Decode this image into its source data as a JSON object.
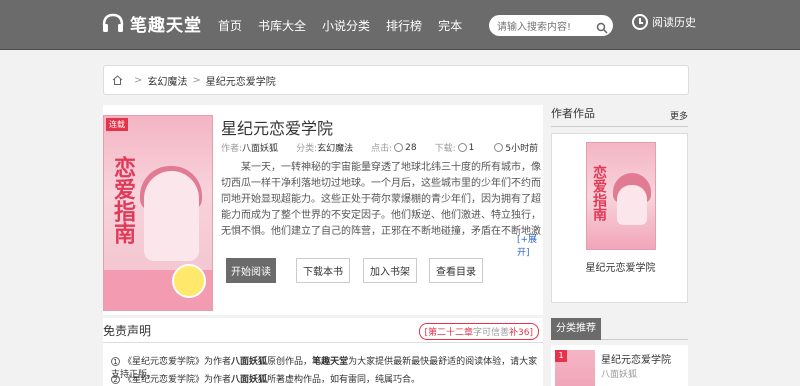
{
  "header": {
    "site_name": "笔趣天堂",
    "nav": [
      "首页",
      "书库大全",
      "小说分类",
      "排行榜",
      "完本"
    ],
    "search_placeholder": "请输入搜索内容!",
    "history_label": "阅读历史"
  },
  "breadcrumb": {
    "category": "玄幻魔法",
    "book": "星纪元恋爱学院"
  },
  "book": {
    "cover_badge": "连载",
    "cover_title": "恋爱指南",
    "title": "星纪元恋爱学院",
    "author_label": "作者:",
    "author": "八面妖狐",
    "category_label": "分类:",
    "category": "玄幻魔法",
    "clicks_label": "点击:",
    "clicks": "28",
    "downloads_label": "下载:",
    "downloads": "1",
    "updated": "5小时前",
    "description": "某一天，一转神秘的宇宙能量穿透了地球北纬三十度的所有城市，像切西瓜一样干净利落地切过地球。一个月后，这些城市里的少年们不约而同地开始显现超能力。这些正处于荷尔蒙爆棚的青少年们，因为拥有了超能力而成为了整个世界的不安定因子。他们叛逆、他们激进、特立独行，无惧不惧。他们建立了自己的阵营，正邪在不断地碰撞，矛盾在不断地激增，终于，第一次世界异能大战发",
    "expand_label": "[+展开]",
    "buttons": {
      "start_reading": "开始阅读",
      "download": "下载本书",
      "add_shelf": "加入书架",
      "view_toc": "查看目录"
    }
  },
  "disclaimer": {
    "title": "免责声明",
    "latest_chapter": "[第二十二章",
    "latest_words": "字可信善",
    "latest_extra": "补36]",
    "line1_a": "《星纪元恋爱学院》",
    "line1_b": "为作者",
    "line1_c": "八面妖狐",
    "line1_d": "原创作品，",
    "line1_e": "笔趣天堂",
    "line1_f": "为大家提供最新最快最舒适的阅读体验，请大家支持正版。",
    "line2_a": "《星纪元恋爱学院》",
    "line2_b": "为作者",
    "line2_c": "八面妖狐",
    "line2_d": "所著虚构作品，如有雷同，纯属巧合。"
  },
  "sidebar": {
    "author_works_title": "作者作品",
    "more_label": "更多",
    "book_title": "星纪元恋爱学院",
    "category_title": "分类推荐",
    "rec_rank": "1",
    "rec_title": "星纪元恋爱学院",
    "rec_author": "八面妖狐"
  }
}
